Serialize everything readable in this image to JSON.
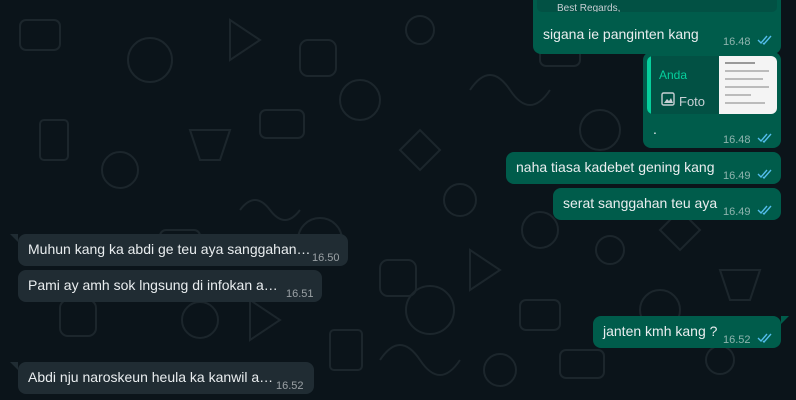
{
  "colors": {
    "background": "#0b141a",
    "outgoing_bubble": "#005c4b",
    "incoming_bubble": "#202c33",
    "read_ticks": "#53bdeb",
    "quote_accent": "#06cf9c"
  },
  "messages": [
    {
      "direction": "outgoing",
      "quoted_text": "Best Regards,",
      "text": "sigana ie panginten kang",
      "time": "16.48",
      "status": "read"
    },
    {
      "direction": "outgoing",
      "reply_author": "Anda",
      "reply_media_label": "Foto",
      "text": ".",
      "time": "16.48",
      "status": "read"
    },
    {
      "direction": "outgoing",
      "text": "naha tiasa kadebet gening kang",
      "time": "16.49",
      "status": "read"
    },
    {
      "direction": "outgoing",
      "text": "serat sanggahan teu aya",
      "time": "16.49",
      "status": "read"
    },
    {
      "direction": "incoming",
      "text": "Muhun kang ka abdi ge teu aya sanggahan…",
      "time": "16.50"
    },
    {
      "direction": "incoming",
      "text": "Pami ay  amh sok lngsung di infokan a…",
      "time": "16.51"
    },
    {
      "direction": "outgoing",
      "text": "janten kmh kang ?",
      "time": "16.52",
      "status": "read"
    },
    {
      "direction": "incoming",
      "text": "Abdi nju naroskeun heula ka kanwil a…",
      "time": "16.52"
    }
  ]
}
